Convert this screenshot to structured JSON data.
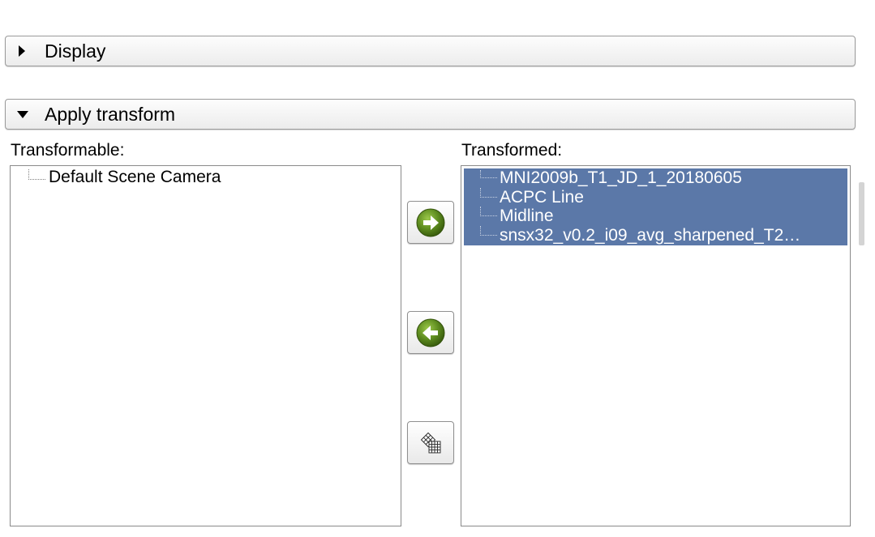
{
  "sections": {
    "display": {
      "title": "Display",
      "expanded": false
    },
    "apply_transform": {
      "title": "Apply transform",
      "expanded": true
    }
  },
  "transformable": {
    "label": "Transformable:",
    "items": [
      {
        "label": "Default Scene Camera",
        "selected": false
      }
    ]
  },
  "transformed": {
    "label": "Transformed:",
    "items": [
      {
        "label": "MNI2009b_T1_JD_1_20180605",
        "selected": true
      },
      {
        "label": "ACPC Line",
        "selected": true
      },
      {
        "label": "Midline",
        "selected": true
      },
      {
        "label": "snsx32_v0.2_i09_avg_sharpened_T2…",
        "selected": true
      }
    ]
  },
  "buttons": {
    "move_right_icon": "green-right-arrow-icon",
    "move_left_icon": "green-left-arrow-icon",
    "reset_icon": "grid-transform-icon"
  },
  "colors": {
    "selection": "#5b78a8",
    "arrow_button_green": "#5c8a1e"
  }
}
